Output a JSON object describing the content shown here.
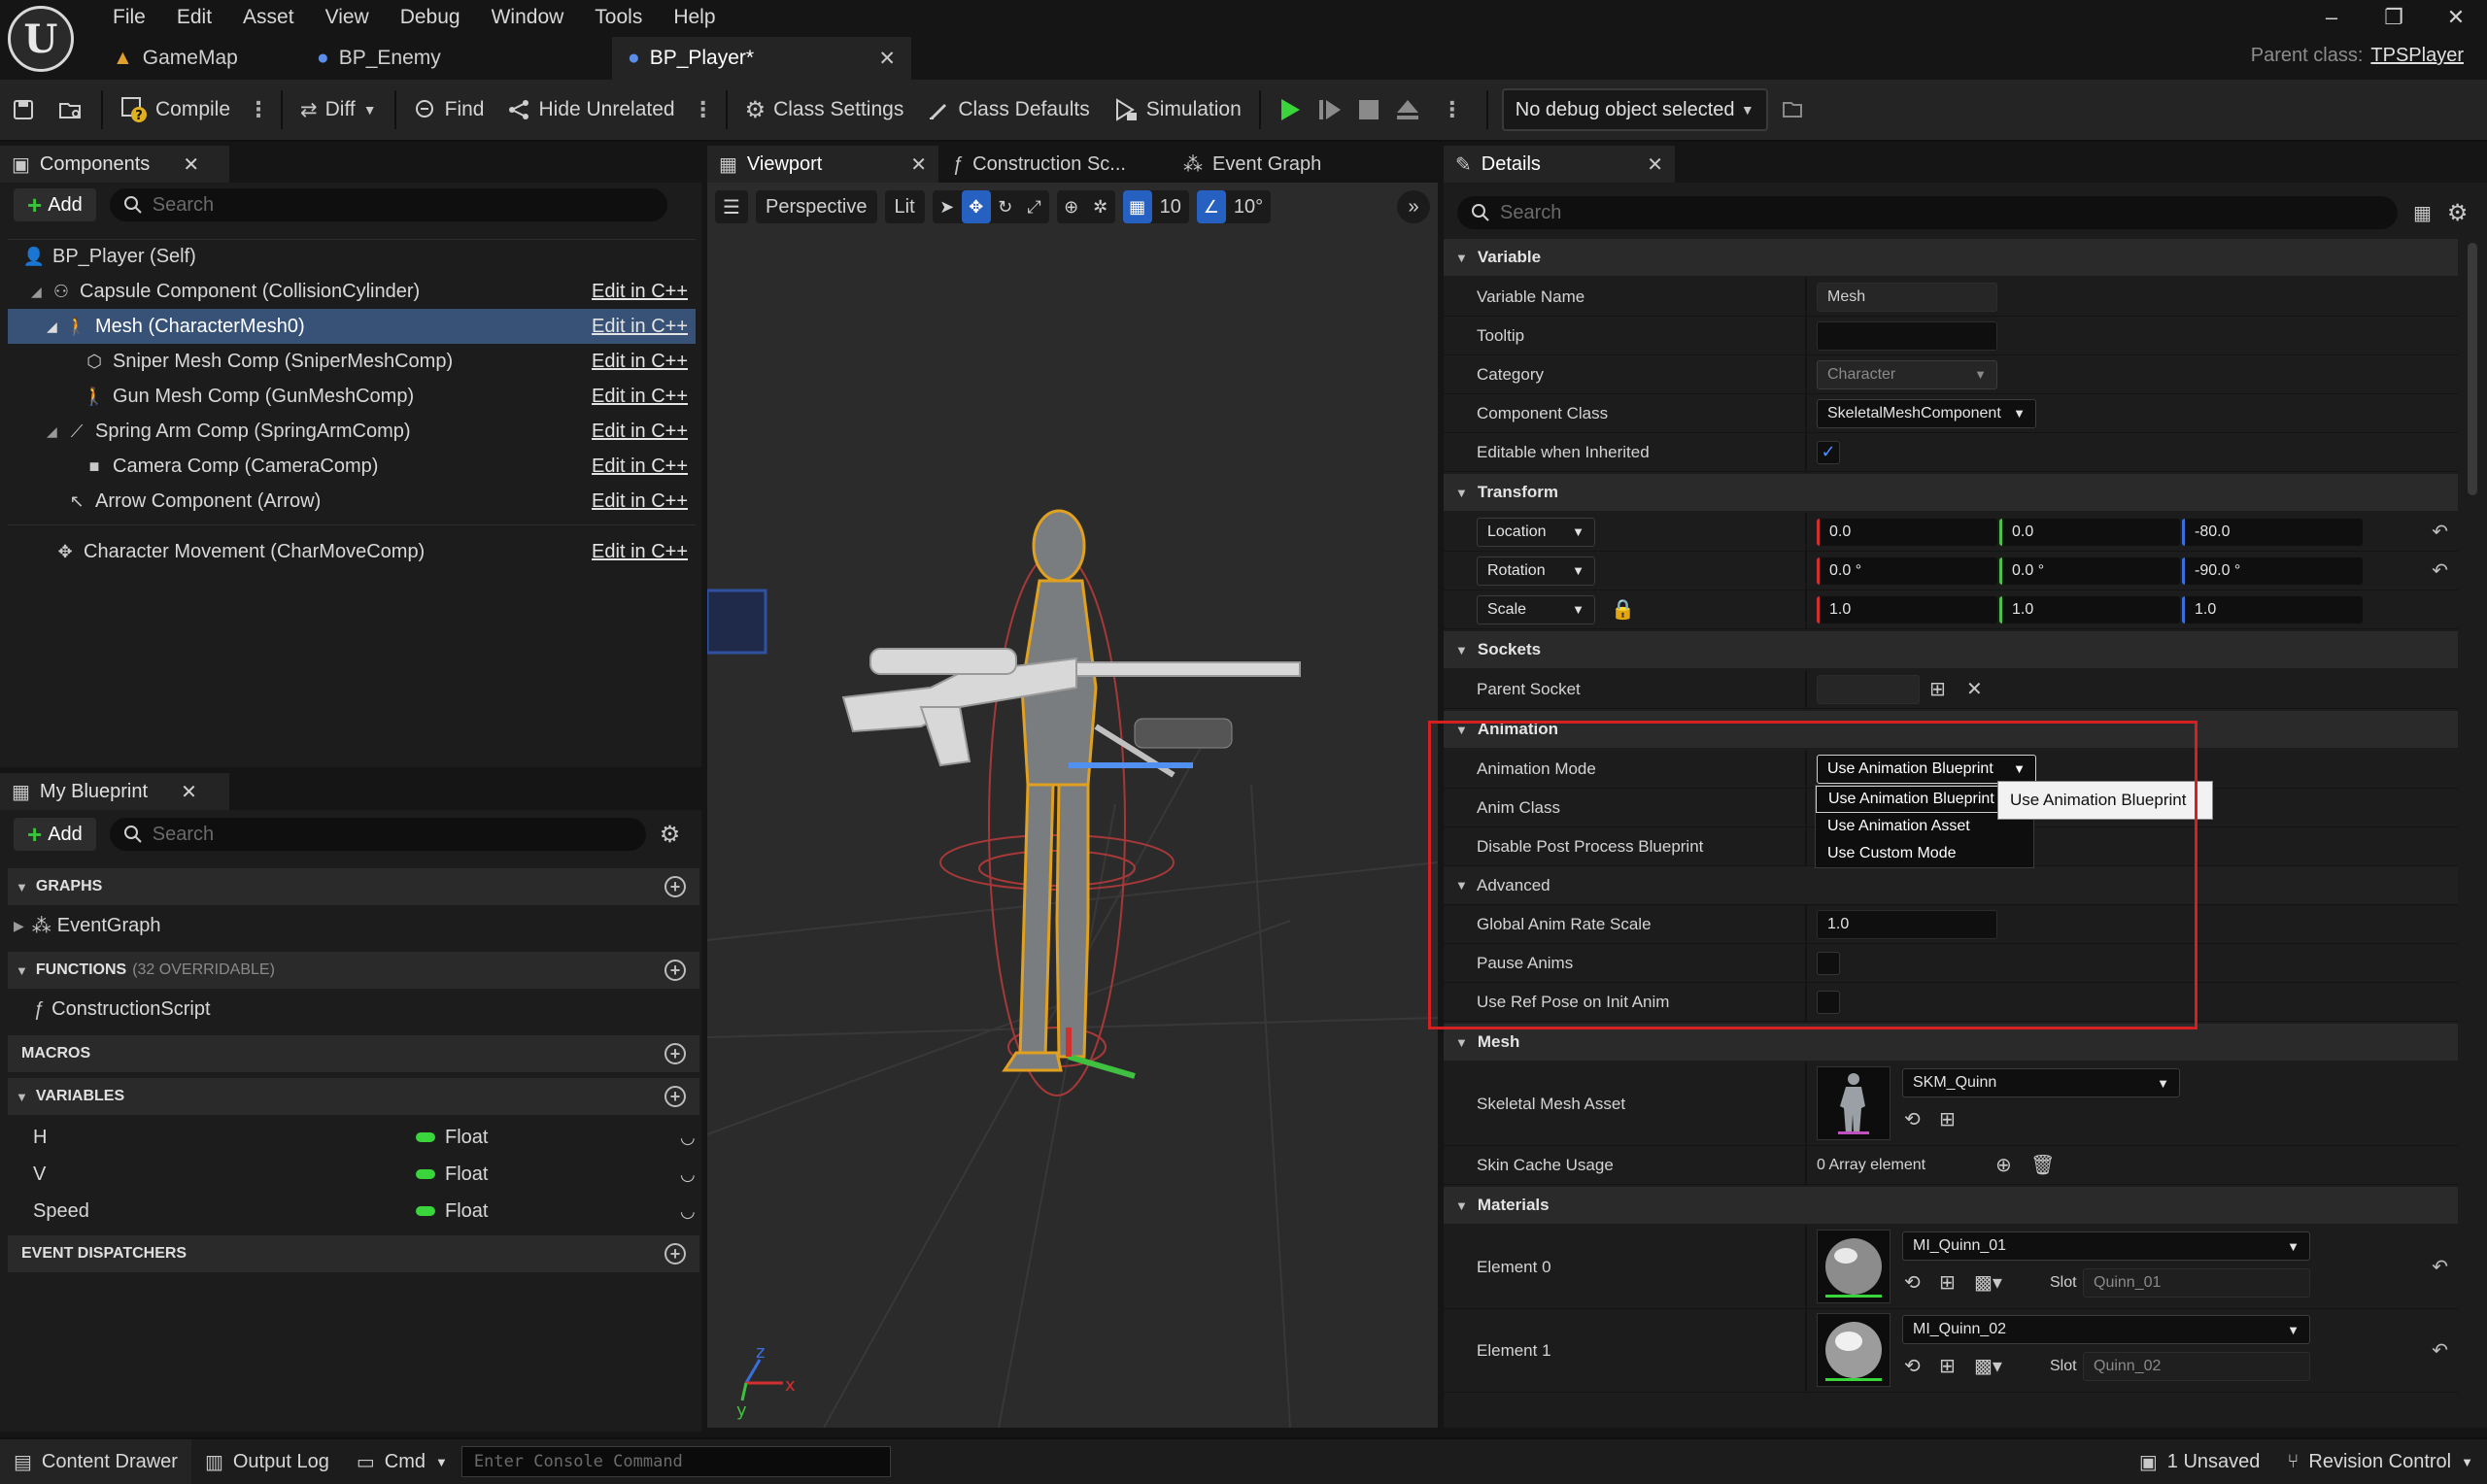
{
  "menu": [
    "File",
    "Edit",
    "Asset",
    "View",
    "Debug",
    "Window",
    "Tools",
    "Help"
  ],
  "doc_tabs": [
    {
      "label": "GameMap",
      "icon": "level-icon"
    },
    {
      "label": "BP_Enemy",
      "icon": "blueprint-icon"
    },
    {
      "label": "BP_Player*",
      "icon": "blueprint-icon",
      "active": true
    }
  ],
  "parent_class": {
    "label": "Parent class:",
    "value": "TPSPlayer"
  },
  "toolbar": {
    "compile": "Compile",
    "diff": "Diff",
    "find": "Find",
    "hide_unrelated": "Hide Unrelated",
    "class_settings": "Class Settings",
    "class_defaults": "Class Defaults",
    "simulation": "Simulation",
    "debug_object": "No debug object selected"
  },
  "components": {
    "tab": "Components",
    "add": "Add",
    "search_placeholder": "Search",
    "edit_label": "Edit in C++",
    "items": [
      {
        "label": "BP_Player (Self)",
        "indent": 0,
        "icon": "person-icon"
      },
      {
        "label": "Capsule Component (CollisionCylinder)",
        "indent": 1,
        "icon": "capsule-icon"
      },
      {
        "label": "Mesh (CharacterMesh0)",
        "indent": 2,
        "icon": "skeletal-mesh-icon",
        "selected": true
      },
      {
        "label": "Sniper Mesh Comp (SniperMeshComp)",
        "indent": 3,
        "icon": "static-mesh-icon"
      },
      {
        "label": "Gun Mesh Comp (GunMeshComp)",
        "indent": 3,
        "icon": "skeletal-mesh-icon"
      },
      {
        "label": "Spring Arm Comp (SpringArmComp)",
        "indent": 2,
        "icon": "spring-arm-icon"
      },
      {
        "label": "Camera Comp (CameraComp)",
        "indent": 3,
        "icon": "camera-icon"
      },
      {
        "label": "Arrow Component (Arrow)",
        "indent": 2,
        "icon": "arrow-icon"
      },
      {
        "label": "Character Movement (CharMoveComp)",
        "indent": 1,
        "icon": "movement-icon"
      }
    ]
  },
  "my_blueprint": {
    "tab": "My Blueprint",
    "add": "Add",
    "search_placeholder": "Search",
    "graphs": "GRAPHS",
    "event_graph": "EventGraph",
    "functions": "FUNCTIONS",
    "functions_sub": "(32 OVERRIDABLE)",
    "construction_script": "ConstructionScript",
    "macros": "MACROS",
    "variables": "VARIABLES",
    "variable_list": [
      {
        "name": "H",
        "type": "Float"
      },
      {
        "name": "V",
        "type": "Float"
      },
      {
        "name": "Speed",
        "type": "Float"
      }
    ],
    "event_dispatchers": "EVENT DISPATCHERS"
  },
  "viewport": {
    "tabs": [
      "Viewport",
      "Construction Sc...",
      "Event Graph"
    ],
    "perspective": "Perspective",
    "lit": "Lit",
    "grid_value": "10",
    "angle_value": "10°"
  },
  "details": {
    "tab": "Details",
    "search_placeholder": "Search",
    "variable_section": "Variable",
    "variable_name_label": "Variable Name",
    "variable_name_value": "Mesh",
    "tooltip_label": "Tooltip",
    "category_label": "Category",
    "category_value": "Character",
    "component_class_label": "Component Class",
    "component_class_value": "SkeletalMeshComponent",
    "editable_label": "Editable when Inherited",
    "transform_section": "Transform",
    "location_label": "Location",
    "location": [
      "0.0",
      "0.0",
      "-80.0"
    ],
    "rotation_label": "Rotation",
    "rotation": [
      "0.0 °",
      "0.0 °",
      "-90.0 °"
    ],
    "scale_label": "Scale",
    "scale": [
      "1.0",
      "1.0",
      "1.0"
    ],
    "sockets_section": "Sockets",
    "parent_socket_label": "Parent Socket",
    "animation_section": "Animation",
    "animation_mode_label": "Animation Mode",
    "animation_mode_value": "Use Animation Blueprint",
    "anim_class_label": "Anim Class",
    "disable_ppb_label": "Disable Post Process Blueprint",
    "advanced_label": "Advanced",
    "global_rate_label": "Global Anim Rate Scale",
    "global_rate_value": "1.0",
    "pause_anims_label": "Pause Anims",
    "ref_pose_label": "Use Ref Pose on Init Anim",
    "mesh_section": "Mesh",
    "skeletal_mesh_label": "Skeletal Mesh Asset",
    "skeletal_mesh_value": "SKM_Quinn",
    "skin_cache_label": "Skin Cache Usage",
    "skin_cache_value": "0 Array element",
    "materials_section": "Materials",
    "slot_label": "Slot",
    "materials": [
      {
        "label": "Element 0",
        "value": "MI_Quinn_01",
        "slot": "Quinn_01"
      },
      {
        "label": "Element 1",
        "value": "MI_Quinn_02",
        "slot": "Quinn_02"
      }
    ]
  },
  "dropdown_options": [
    "Use Animation Blueprint",
    "Use Animation Asset",
    "Use Custom Mode"
  ],
  "tooltip": "Use Animation Blueprint",
  "bottom": {
    "content_drawer": "Content Drawer",
    "output_log": "Output Log",
    "cmd": "Cmd",
    "console_placeholder": "Enter Console Command",
    "unsaved": "1 Unsaved",
    "revision_control": "Revision Control"
  },
  "colors": {
    "accent_blue": "#2660c0",
    "selection": "#375177",
    "play_green": "#3ad53a",
    "highlight_red": "#d42020"
  }
}
